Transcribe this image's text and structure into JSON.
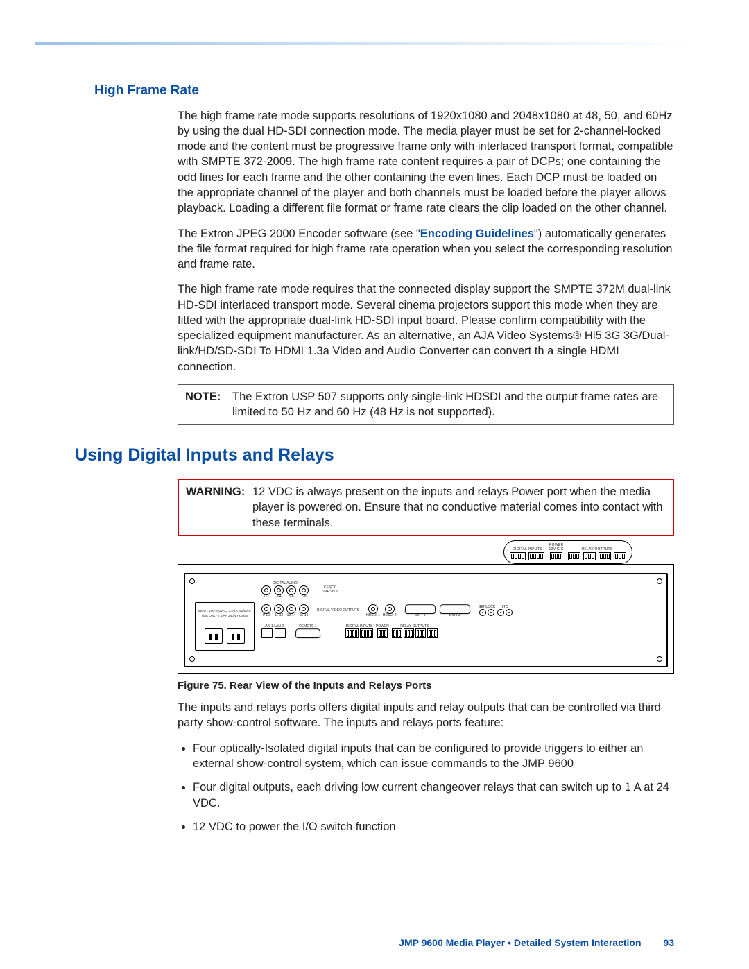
{
  "section_hfr": {
    "heading": "High Frame Rate",
    "p1": "The high frame rate mode supports resolutions of 1920x1080 and 2048x1080 at 48, 50, and 60Hz by using the dual HD-SDI connection mode. The media player must be set for 2-channel-locked mode and the content must be progressive frame only with interlaced transport format, compatible with SMPTE 372-2009. The high frame rate content requires a pair of DCPs; one containing the odd lines for each frame and the other containing the even lines. Each DCP must be loaded on the appropriate channel of the player and both channels must be loaded before the player allows playback. Loading a different file format or frame rate clears the clip loaded on the other channel.",
    "p2_pre": "The Extron JPEG 2000 Encoder software (see \"",
    "p2_link": "Encoding Guidelines",
    "p2_post": "\") automatically generates the file format required for high frame rate operation when you select the corresponding resolution and frame rate.",
    "p3": "The high frame rate mode requires that the connected display support the SMPTE 372M dual-link HD-SDI interlaced transport mode. Several cinema projectors support this mode when they are fitted with the appropriate dual-link HD-SDI input board. Please confirm compatibility with the specialized equipment manufacturer. As an alternative, an AJA Video Systems® Hi5 3G 3G/Dual-link/HD/SD-SDI To HDMI 1.3a Video and Audio Converter can convert th a single HDMI connection.",
    "note_label": "NOTE:",
    "note_text": "The Extron USP 507 supports only single-link HDSDI and the output frame rates are limited to 50 Hz and 60 Hz (48 Hz is not supported)."
  },
  "section_relay": {
    "heading": "Using Digital Inputs and Relays",
    "warn_label": "WARNING:",
    "warn_text": "12 VDC is always present on the inputs and relays Power port when the media player is powered on. Ensure that no conductive material comes into contact with these terminals.",
    "callout_labels": {
      "digital_inputs": "DIGITAL INPUTS",
      "power": "POWER",
      "power_sub": "12V  G  G",
      "relay_outputs": "RELAY OUTPUTS"
    },
    "panel_labels": {
      "input_spec": "INPUT: 100-240VAC, 3.4-1A, 50/60Hz   USE ONLY 7.5 AH 240W FUSES",
      "digital_audio": "DIGITAL AUDIO",
      "digital_video_outputs": "DIGITAL VIDEO OUTPUTS",
      "lan": "LAN 1   LAN 2",
      "remote": "REMOTE 1",
      "pairs_top": [
        "1-2",
        "3-4",
        "5-6",
        "7-8"
      ],
      "pairs_mid": [
        "9-10",
        "11-12",
        "13-14",
        "15-16"
      ],
      "hdsdi": [
        "HDSDI 1",
        "HDSDI 2"
      ],
      "dvi": [
        "DVI-I 1",
        "DVI-I 2"
      ],
      "genlock": "GENLOCK",
      "ltc": "LTC",
      "sync": [
        "IN",
        "OUT",
        "IN",
        "OUT"
      ],
      "relay_hdr_di": "DIGITAL INPUTS",
      "relay_hdr_pw": "POWER",
      "relay_hdr_ro": "RELAY OUTPUTS",
      "cefcc": "CE FCC",
      "model": "JMP 9600"
    },
    "figure_caption_lead": "Figure 75.",
    "figure_caption_text": " Rear View of the Inputs and Relays Ports",
    "intro": "The inputs and relays ports offers digital inputs and relay outputs that can be controlled via third party show-control software. The inputs and relays ports feature:",
    "bullets": [
      "Four optically-Isolated digital inputs that can be configured to provide triggers to either an external show-control system, which can issue commands to the JMP 9600",
      "Four digital outputs, each driving low current changeover relays that can switch up to 1 A at 24 VDC.",
      "12 VDC to power the I/O switch function"
    ]
  },
  "footer": {
    "text": "JMP 9600 Media Player • Detailed System Interaction",
    "page": "93"
  }
}
